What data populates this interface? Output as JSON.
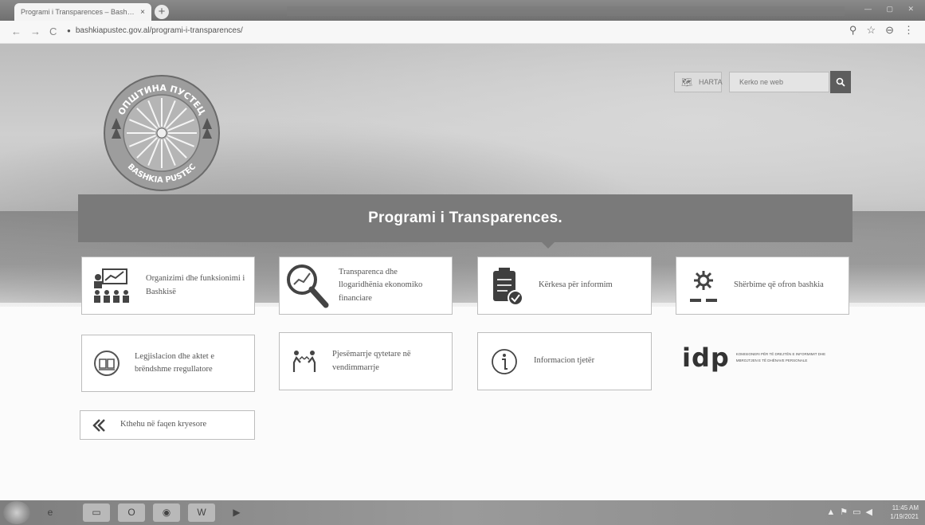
{
  "browser": {
    "tab_title": "Programi i Transparences – Bash…",
    "tab_close": "×",
    "new_tab": "+",
    "url": "bashkiapustec.gov.al/programi-i-transparences/",
    "back": "←",
    "forward": "→",
    "reload": "C"
  },
  "header": {
    "map_label": "HARTA",
    "search_placeholder": "Kerko ne web",
    "logo_text_top": "ОПШТИНА ПУСТЕЦ",
    "logo_text_bottom": "BASHKIA PUSTEC"
  },
  "banner": {
    "title": "Programi i Transparences."
  },
  "cards": [
    {
      "label": "Organizimi dhe funksionimi i Bashkisë",
      "icon": "organization-chart-icon"
    },
    {
      "label": "Transparenca dhe llogaridhënia ekonomiko financiare",
      "icon": "magnifier-chart-icon"
    },
    {
      "label": "Kërkesa për informim",
      "icon": "clipboard-check-icon"
    },
    {
      "label": "Shërbime që ofron bashkia",
      "icon": "gear-icon"
    },
    {
      "label": "Legjislacion dhe aktet e brëndshme rregullatore",
      "icon": "book-icon"
    },
    {
      "label": "Pjesëmarrje qytetare në vendimmarrje",
      "icon": "people-arrows-icon"
    },
    {
      "label": "Informacion tjetër",
      "icon": "info-icon"
    },
    {
      "label": "Kthehu në faqen kryesore",
      "icon": "back-arrow-icon"
    }
  ],
  "partner": {
    "mark": "idp",
    "caption": "KOMISIONERI PËR TË DREJTËN E INFORMIMIT DHE MBROJTJEN E TË DHËNAVE PERSONALE"
  },
  "taskbar": {
    "time": "11:45 AM",
    "date": "1/19/2021"
  }
}
